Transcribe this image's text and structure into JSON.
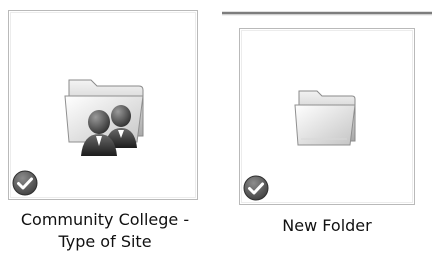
{
  "items": [
    {
      "name": "Community College - Type of Site",
      "label_line1": "Community College -",
      "label_line2": "Type of Site",
      "icon": "group-folder-icon",
      "status_icon": "checkmark-badge-icon"
    },
    {
      "name": "New Folder",
      "label_line1": "New Folder",
      "icon": "folder-icon",
      "status_icon": "checkmark-badge-icon"
    }
  ],
  "colors": {
    "border": "#b9b9b9",
    "check_badge": "#4a4a4a"
  }
}
